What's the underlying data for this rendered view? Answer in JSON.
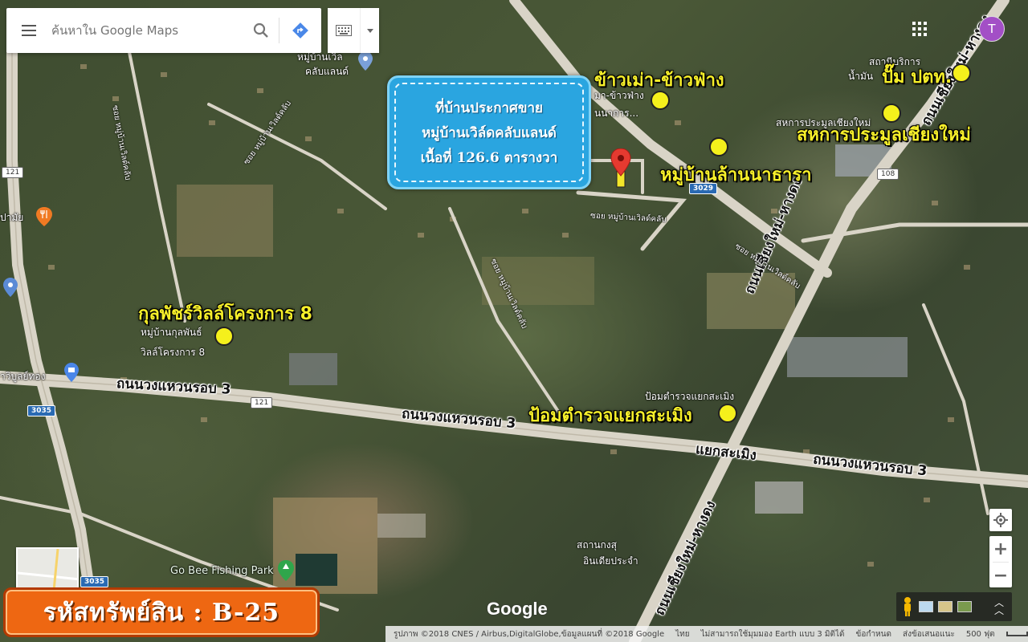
{
  "search": {
    "placeholder": "ค้นหาใน Google Maps"
  },
  "account": {
    "initial": "T"
  },
  "callout": {
    "line1": "ที่บ้านประกาศขาย",
    "line2": "หมู่บ้านเวิล์ดคลับแลนด์",
    "line3": "เนื้อที่ 126.6 ตารางวา"
  },
  "landmarks": {
    "khaomao": "ข้าวเม่า-ข้าวฟ่าง",
    "ptt": "ปั๊ม ปตท.",
    "cooperative": "สหการประมูลเชียงใหม่",
    "lannathara": "หมู่บ้านล้านนาธารา",
    "kulaphat": "กุลพัชร์วิลล์โครงการ 8",
    "police": "ป้อมตำรวจแยกสะเมิง"
  },
  "map_labels": {
    "worldclub_small": "คลับแลนด์",
    "worldclub_small_top": "หมู่บ้านเวิล",
    "khaomao_small": "มา-ข้าวฟ่าง",
    "khaomao_small2": "นนาการ...",
    "ptt_small": "สถานีบริการ",
    "ptt_small2": "น้ำมัน",
    "coop_small": "สหการประมูลเชียงใหม่",
    "kulaphat_small1": "หมู่บ้านกุลพันธ์",
    "kulaphat_small2": "วิลล์โครงการ 8",
    "police_small": "ป้อมตำรวจแยกสะเมิง",
    "fishing_park": "Go Bee Fishing Park",
    "school_small1": "สถานกงสุ",
    "school_small2": "อินเดียประจำ",
    "kamthong": "าวิบูลย์ทอง",
    "banmai": "ปามัย"
  },
  "roads": {
    "ring3_a": "ถนนวงแหวนรอบ 3",
    "ring3_b": "ถนนวงแหวนรอบ 3",
    "ring3_c": "ถนนวงแหวนรอบ 3",
    "samoeng": "แยกสะเมิง",
    "cm_hangdong_a": "ถนนเชียงใหม่-หางดง",
    "cm_hangdong_b": "ถนนเชียงใหม่-หางดง",
    "cm_hangdong_c": "ถนนเชียงใหม่-หางดง",
    "soi1": "ซอย หมู่บ้านเวิลด์คลับ",
    "soi2": "ซอย หมู่บ้านเวิลด์คลับ",
    "soi3": "ซอย หมู่บ้านเวิลด์คลับ",
    "soi4": "ซอย หมู่บ้านเวิลด์คลับ",
    "soi5": "ซอย หมู่บ้านเวิลด์คลับ"
  },
  "shields": {
    "r121a": "121",
    "r121b": "121",
    "r3035a": "3035",
    "r3035b": "3035",
    "r3029": "3029",
    "r108": "108"
  },
  "attribution": {
    "imagery": "รูปภาพ ©2018 CNES / Airbus,DigitalGlobe,ข้อมูลแผนที่ ©2018 Google",
    "lang": "ไทย",
    "earth": "ไม่สามารถใช้มุมมอง Earth แบบ 3 มิติได้",
    "terms": "ข้อกำหนด",
    "feedback": "ส่งข้อเสนอแนะ",
    "scale": "500 ฟุต"
  },
  "google_logo": "Google",
  "badge": {
    "text": "รหัสทรัพย์สิน : B-25"
  }
}
